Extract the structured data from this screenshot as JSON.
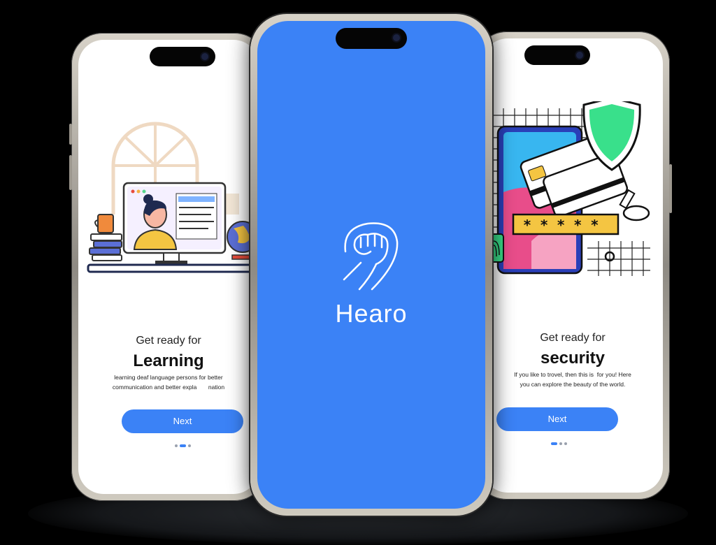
{
  "screens": {
    "left": {
      "subtitle": "Get ready for",
      "title": "Learning",
      "description_line1": "learning deaf language persons for better",
      "description_line2": "communication and better expla       nation",
      "button_label": "Next",
      "page_indicator": {
        "total": 3,
        "active": 2
      }
    },
    "center": {
      "app_name": "Hearo",
      "logo_icon": "raised-fist-hand-icon"
    },
    "right": {
      "subtitle": "Get ready for",
      "title": "security",
      "description_line1": "If you like to trovel, then this is  for you! Here",
      "description_line2": "you can explore the beauty of the world.",
      "button_label": "Next",
      "password_mask": "* * * * *",
      "page_indicator": {
        "total": 3,
        "active": 1
      }
    }
  },
  "colors": {
    "accent": "#3b82f6",
    "background": "#000000",
    "screen": "#ffffff"
  }
}
